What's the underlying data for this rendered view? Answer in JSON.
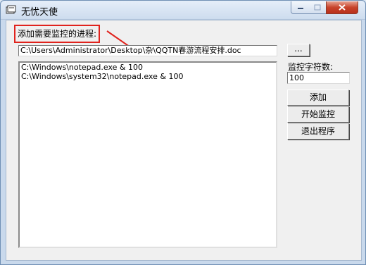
{
  "window": {
    "title": "无忧天使"
  },
  "form": {
    "process_label": "添加需要监控的进程:",
    "file_path_value": "C:\\Users\\Administrator\\Desktop\\杂\\QQTN春游流程安排.doc",
    "browse_label": "...",
    "process_list": [
      "C:\\Windows\\notepad.exe & 100",
      "C:\\Windows\\system32\\notepad.exe & 100"
    ],
    "char_count_label": "监控字符数:",
    "char_count_value": "100"
  },
  "buttons": {
    "add_label": "添加",
    "start_label": "开始监控",
    "exit_label": "退出程序"
  },
  "colors": {
    "annotation_red": "#e0231d",
    "close_button": "#c7432b"
  }
}
